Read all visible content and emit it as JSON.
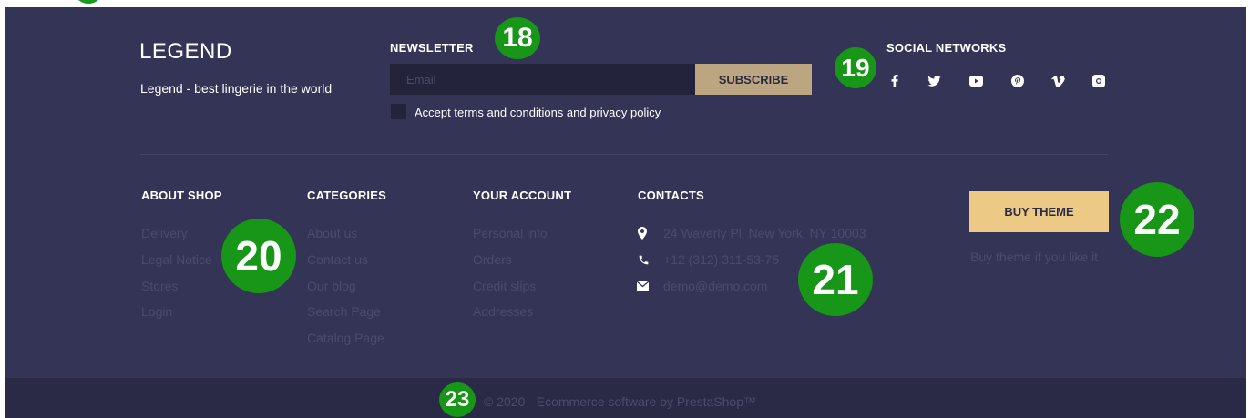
{
  "brand": {
    "logo": "LEGEND",
    "tagline": "Legend - best lingerie in the world"
  },
  "newsletter": {
    "heading": "NEWSLETTER",
    "email_placeholder": "Email",
    "email_value": "",
    "subscribe_label": "SUBSCRIBE",
    "terms_label": "Accept terms and conditions and privacy policy",
    "terms_checked": false
  },
  "social": {
    "heading": "SOCIAL NETWORKS",
    "icons": [
      "facebook-icon",
      "twitter-icon",
      "youtube-icon",
      "pinterest-icon",
      "vimeo-icon",
      "instagram-icon"
    ]
  },
  "about_shop": {
    "heading": "ABOUT SHOP",
    "links": [
      "Delivery",
      "Legal Notice",
      "Stores",
      "Login"
    ]
  },
  "categories": {
    "heading": "CATEGORIES",
    "links": [
      "About us",
      "Contact us",
      "Our blog",
      "Search Page",
      "Catalog Page"
    ]
  },
  "your_account": {
    "heading": "YOUR ACCOUNT",
    "links": [
      "Personal info",
      "Orders",
      "Credit slips",
      "Addresses"
    ]
  },
  "contacts": {
    "heading": "CONTACTS",
    "address": "24 Waverly Pl, New York, NY 10003",
    "phone": "+12 (312) 311-53-75",
    "email": "demo@demo.com"
  },
  "buy_theme": {
    "button_label": "BUY THEME",
    "note": "Buy theme if you like it"
  },
  "copyright": "© 2020 - Ecommerce software by PrestaShop™",
  "markers": [
    "18",
    "19",
    "20",
    "21",
    "22",
    "23"
  ],
  "colors": {
    "footer_bg": "#343456",
    "bottom_bar_bg": "#2a2a46",
    "subscribe_bg": "#bba681",
    "buy_theme_bg": "#ecc985",
    "muted_text": "#4b4b6e",
    "marker_green": "#179617"
  }
}
